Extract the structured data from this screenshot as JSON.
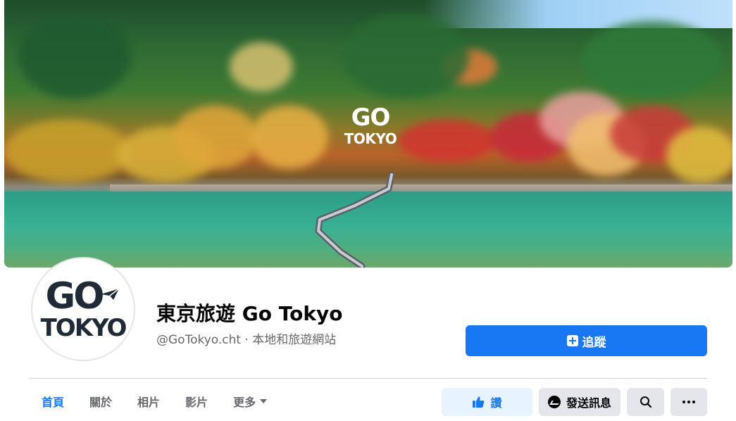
{
  "cover": {
    "brand_go": "GO",
    "brand_tokyo": "TOKYO"
  },
  "avatar": {
    "go": "GO",
    "tokyo": "TOKYO"
  },
  "page": {
    "title": "東京旅遊 Go Tokyo",
    "subtitle": "@GoTokyo.cht · 本地和旅遊網站"
  },
  "follow_button": {
    "label": "追蹤",
    "icon": "follow-plus-icon"
  },
  "tabs": [
    {
      "label": "首頁",
      "active": true
    },
    {
      "label": "關於"
    },
    {
      "label": "相片"
    },
    {
      "label": "影片"
    },
    {
      "label": "更多",
      "has_caret": true
    }
  ],
  "actions": {
    "like_label": "讚",
    "message_label": "發送訊息",
    "search_icon": "search-icon",
    "more_icon": "more-dots-icon"
  },
  "colors": {
    "brand_blue": "#1877f2",
    "light_blue": "#e7f3ff",
    "button_gray": "#e4e6eb",
    "secondary_text": "#65676b"
  }
}
